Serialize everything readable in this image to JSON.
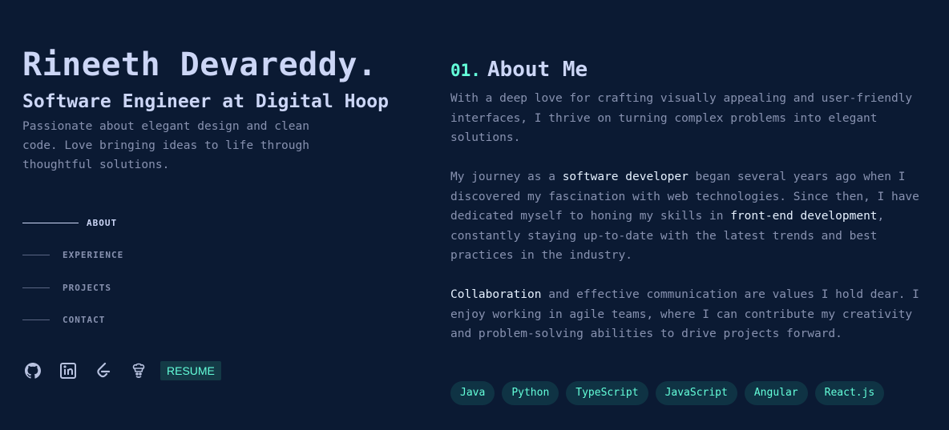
{
  "profile": {
    "name": "Rineeth Devareddy.",
    "role": "Software Engineer at Digital Hoop",
    "tagline": "Passionate about elegant design and clean code. Love bringing ideas to life through thoughtful solutions."
  },
  "nav": {
    "items": [
      {
        "label": "ABOUT",
        "active": true
      },
      {
        "label": "EXPERIENCE",
        "active": false
      },
      {
        "label": "PROJECTS",
        "active": false
      },
      {
        "label": "CONTACT",
        "active": false
      }
    ]
  },
  "socials": {
    "icons": [
      "github-icon",
      "linkedin-icon",
      "leetcode-icon",
      "codechef-icon"
    ],
    "resume_label": "RESUME"
  },
  "about": {
    "number": "01.",
    "title": "About Me",
    "p1": "With a deep love for crafting visually appealing and user-friendly interfaces, I thrive on turning complex problems into elegant solutions.",
    "p2_a": "My journey as a ",
    "p2_h1": "software developer",
    "p2_b": " began several years ago when I discovered my fascination with web technologies. Since then, I have dedicated myself to honing my skills in ",
    "p2_h2": "front-end development",
    "p2_c": ", constantly staying up-to-date with the latest trends and best practices in the industry.",
    "p3_h": "Collaboration",
    "p3_b": " and effective communication are values I hold dear. I enjoy working in agile teams, where I can contribute my creativity and problem-solving abilities to drive projects forward."
  },
  "skills": [
    "Java",
    "Python",
    "TypeScript",
    "JavaScript",
    "Angular",
    "React.js"
  ],
  "colors": {
    "background": "#0b1a33",
    "accent": "#64ffda",
    "heading": "#ccd6f6",
    "body": "#8892b0"
  }
}
